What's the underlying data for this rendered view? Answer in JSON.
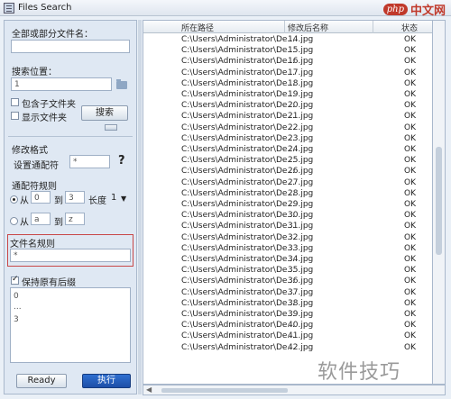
{
  "window": {
    "title": "Files Search"
  },
  "logo": {
    "brand": "php",
    "suffix": "中文网"
  },
  "left": {
    "filename_label": "全部或部分文件名：",
    "filename_value": "",
    "location_label": "搜索位置：",
    "location_value": "",
    "location_num": "1",
    "include_subfolders_label": "包含子文件夹",
    "show_folders_label": "显示文件夹",
    "search_button": "搜索",
    "modify_format_label": "修改格式",
    "wildcard_label": "设置通配符",
    "wildcard_value": "*",
    "help_symbol": "?",
    "wildcard_rule_label": "通配符规则",
    "from_label": "从",
    "from_value": "0",
    "to_label": "到",
    "to_value": "3",
    "length_label": "长度",
    "length_value": "1",
    "from2_label": "从",
    "from2_value": "a",
    "to2_label": "到",
    "to2_value": "z",
    "filename_rule_label": "文件名规则",
    "filename_rule_value": "*",
    "keep_suffix_label": "保持原有后缀",
    "list_items": [
      "0",
      "...",
      "3"
    ],
    "ready_button": "Ready",
    "execute_button": "执行"
  },
  "table": {
    "columns": [
      "所在路径",
      "修改后名称",
      "状态"
    ],
    "rows": [
      {
        "path": "C:\\Users\\Administrator\\De...",
        "name": "14.jpg",
        "status": "OK"
      },
      {
        "path": "C:\\Users\\Administrator\\De...",
        "name": "15.jpg",
        "status": "OK"
      },
      {
        "path": "C:\\Users\\Administrator\\De...",
        "name": "16.jpg",
        "status": "OK"
      },
      {
        "path": "C:\\Users\\Administrator\\De...",
        "name": "17.jpg",
        "status": "OK"
      },
      {
        "path": "C:\\Users\\Administrator\\De...",
        "name": "18.jpg",
        "status": "OK"
      },
      {
        "path": "C:\\Users\\Administrator\\De...",
        "name": "19.jpg",
        "status": "OK"
      },
      {
        "path": "C:\\Users\\Administrator\\De...",
        "name": "20.jpg",
        "status": "OK"
      },
      {
        "path": "C:\\Users\\Administrator\\De...",
        "name": "21.jpg",
        "status": "OK"
      },
      {
        "path": "C:\\Users\\Administrator\\De...",
        "name": "22.jpg",
        "status": "OK"
      },
      {
        "path": "C:\\Users\\Administrator\\De...",
        "name": "23.jpg",
        "status": "OK"
      },
      {
        "path": "C:\\Users\\Administrator\\De...",
        "name": "24.jpg",
        "status": "OK"
      },
      {
        "path": "C:\\Users\\Administrator\\De...",
        "name": "25.jpg",
        "status": "OK"
      },
      {
        "path": "C:\\Users\\Administrator\\De...",
        "name": "26.jpg",
        "status": "OK"
      },
      {
        "path": "C:\\Users\\Administrator\\De...",
        "name": "27.jpg",
        "status": "OK"
      },
      {
        "path": "C:\\Users\\Administrator\\De...",
        "name": "28.jpg",
        "status": "OK"
      },
      {
        "path": "C:\\Users\\Administrator\\De...",
        "name": "29.jpg",
        "status": "OK"
      },
      {
        "path": "C:\\Users\\Administrator\\De...",
        "name": "30.jpg",
        "status": "OK"
      },
      {
        "path": "C:\\Users\\Administrator\\De...",
        "name": "31.jpg",
        "status": "OK"
      },
      {
        "path": "C:\\Users\\Administrator\\De...",
        "name": "32.jpg",
        "status": "OK"
      },
      {
        "path": "C:\\Users\\Administrator\\De...",
        "name": "33.jpg",
        "status": "OK"
      },
      {
        "path": "C:\\Users\\Administrator\\De...",
        "name": "34.jpg",
        "status": "OK"
      },
      {
        "path": "C:\\Users\\Administrator\\De...",
        "name": "35.jpg",
        "status": "OK"
      },
      {
        "path": "C:\\Users\\Administrator\\De...",
        "name": "36.jpg",
        "status": "OK"
      },
      {
        "path": "C:\\Users\\Administrator\\De...",
        "name": "37.jpg",
        "status": "OK"
      },
      {
        "path": "C:\\Users\\Administrator\\De...",
        "name": "38.jpg",
        "status": "OK"
      },
      {
        "path": "C:\\Users\\Administrator\\De...",
        "name": "39.jpg",
        "status": "OK"
      },
      {
        "path": "C:\\Users\\Administrator\\De...",
        "name": "40.jpg",
        "status": "OK"
      },
      {
        "path": "C:\\Users\\Administrator\\De...",
        "name": "41.jpg",
        "status": "OK"
      },
      {
        "path": "C:\\Users\\Administrator\\De...",
        "name": "42.jpg",
        "status": "OK"
      }
    ]
  },
  "watermark": "软件技巧",
  "colors": {
    "accent": "#1d4fa8",
    "rule_border": "#c84848",
    "logo_red": "#c0392b"
  }
}
